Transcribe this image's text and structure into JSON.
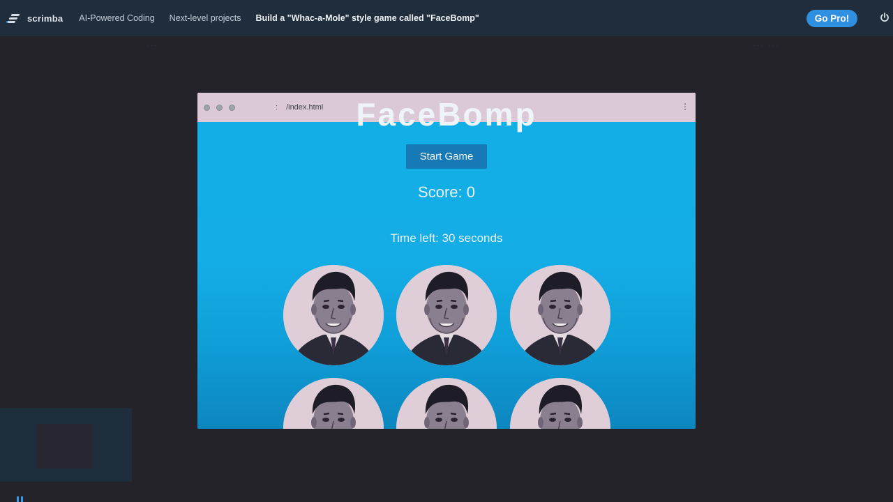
{
  "topbar": {
    "brand": "scrimba",
    "breadcrumbs": [
      "AI-Powered Coding",
      "Next-level projects",
      "Build a \"Whac-a-Mole\" style game called \"FaceBomp\""
    ],
    "go_pro_label": "Go Pro!",
    "power_icon": "power-icon",
    "accent_color": "#2f8fe0"
  },
  "browser": {
    "url": "/index.html",
    "colon": ":",
    "menu_glyph": "⋮",
    "background_color": "#10a6df"
  },
  "game": {
    "title": "FaceBomp",
    "start_button_label": "Start Game",
    "score_text": "Score: 0",
    "timer_text": "Time left: 30 seconds",
    "holes": [
      {
        "id": 1
      },
      {
        "id": 2
      },
      {
        "id": 3
      },
      {
        "id": 4
      },
      {
        "id": 5
      },
      {
        "id": 6
      }
    ]
  },
  "webcam": {
    "label": ""
  }
}
